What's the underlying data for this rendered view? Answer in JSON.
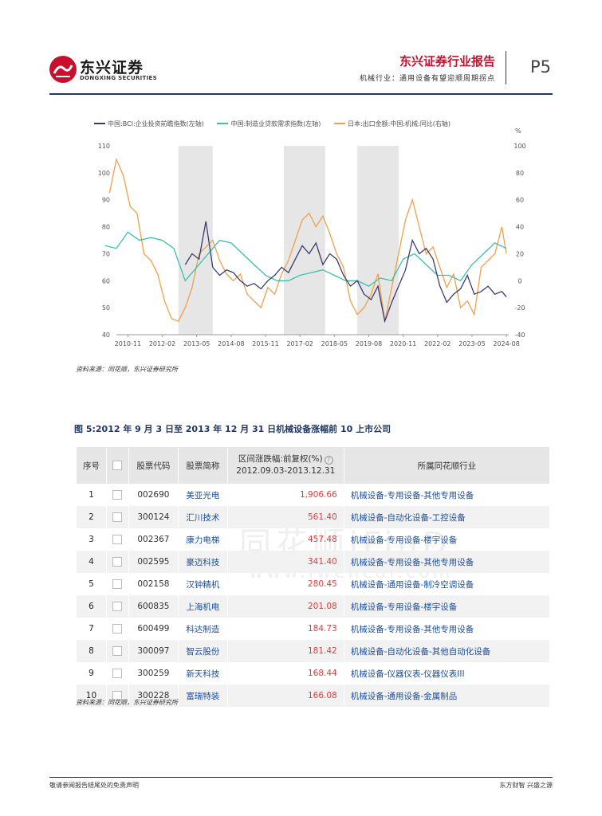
{
  "header": {
    "logo_cn": "东兴证券",
    "logo_en": "DONGXING SECURITIES",
    "report_title": "东兴证券行业报告",
    "report_subtitle": "机械行业：通用设备有望迎顺周期拐点",
    "page": "P5"
  },
  "chart_data": {
    "type": "line",
    "legend": [
      "中国:BCI:企业投资前瞻指数(左轴)",
      "中国:制造业贷款需求指数(左轴)",
      "日本:出口金额:中国:机械:同比(右轴)"
    ],
    "colors": [
      "#3b3b6e",
      "#3cbfae",
      "#f0a04b"
    ],
    "x_ticks": [
      "2010-11",
      "2012-02",
      "2013-05",
      "2014-08",
      "2015-11",
      "2017-02",
      "2018-05",
      "2019-08",
      "2020-11",
      "2022-02",
      "2023-05",
      "2024-08"
    ],
    "y_left_ticks": [
      "110",
      "100",
      "90",
      "80",
      "70",
      "60",
      "50",
      "40"
    ],
    "y_right_ticks": [
      "100",
      "80",
      "60",
      "40",
      "20",
      "0",
      "-20",
      "-40"
    ],
    "y_right_unit": "%",
    "y_left_range": [
      40,
      110
    ],
    "y_right_range": [
      -40,
      100
    ],
    "shaded_periods": [
      [
        "2012-09",
        "2013-12"
      ],
      [
        "2016-07",
        "2018-01"
      ],
      [
        "2019-03",
        "2020-09"
      ]
    ],
    "series": [
      {
        "name": "中国:BCI:企业投资前瞻指数(左轴)",
        "x": [
          "2012-12",
          "2013-03",
          "2013-06",
          "2013-09",
          "2013-12",
          "2014-03",
          "2014-06",
          "2014-09",
          "2014-12",
          "2015-03",
          "2015-06",
          "2015-09",
          "2015-12",
          "2016-03",
          "2016-06",
          "2016-09",
          "2016-12",
          "2017-03",
          "2017-06",
          "2017-09",
          "2017-12",
          "2018-03",
          "2018-06",
          "2018-09",
          "2018-12",
          "2019-03",
          "2019-06",
          "2019-09",
          "2019-12",
          "2020-03",
          "2020-06",
          "2020-09",
          "2020-12",
          "2021-03",
          "2021-06",
          "2021-09",
          "2021-12",
          "2022-03",
          "2022-06",
          "2022-09",
          "2022-12",
          "2023-03",
          "2023-06",
          "2023-09",
          "2023-12",
          "2024-03",
          "2024-06",
          "2024-08"
        ],
        "values": [
          66,
          70,
          68,
          82,
          65,
          62,
          64,
          63,
          60,
          58,
          59,
          57,
          60,
          62,
          65,
          63,
          68,
          73,
          70,
          74,
          66,
          70,
          68,
          62,
          58,
          60,
          55,
          53,
          58,
          45,
          52,
          58,
          64,
          75,
          70,
          72,
          68,
          58,
          52,
          55,
          57,
          62,
          55,
          56,
          58,
          55,
          56,
          54
        ]
      },
      {
        "name": "中国:制造业贷款需求指数(左轴)",
        "x": [
          "2010-01",
          "2010-06",
          "2010-11",
          "2011-04",
          "2011-09",
          "2012-02",
          "2012-07",
          "2012-12",
          "2013-05",
          "2013-10",
          "2014-03",
          "2014-08",
          "2015-01",
          "2015-06",
          "2015-11",
          "2016-04",
          "2016-09",
          "2017-02",
          "2017-07",
          "2017-12",
          "2018-05",
          "2018-10",
          "2019-03",
          "2019-08",
          "2020-01",
          "2020-06",
          "2020-11",
          "2021-04",
          "2021-09",
          "2022-02",
          "2022-07",
          "2022-12",
          "2023-05",
          "2023-10",
          "2024-03",
          "2024-08"
        ],
        "values": [
          73,
          72,
          78,
          75,
          76,
          75,
          72,
          60,
          65,
          70,
          75,
          74,
          70,
          66,
          62,
          60,
          60,
          62,
          63,
          64,
          62,
          60,
          60,
          58,
          61,
          60,
          68,
          70,
          66,
          62,
          62,
          60,
          66,
          70,
          74,
          72
        ]
      },
      {
        "name": "日本:出口金额:中国:机械:同比(右轴)",
        "x": [
          "2010-03",
          "2010-06",
          "2010-09",
          "2010-12",
          "2011-03",
          "2011-06",
          "2011-09",
          "2011-12",
          "2012-03",
          "2012-06",
          "2012-09",
          "2012-12",
          "2013-03",
          "2013-06",
          "2013-09",
          "2013-12",
          "2014-03",
          "2014-06",
          "2014-09",
          "2014-12",
          "2015-03",
          "2015-06",
          "2015-09",
          "2015-12",
          "2016-03",
          "2016-06",
          "2016-09",
          "2016-12",
          "2017-03",
          "2017-06",
          "2017-09",
          "2017-12",
          "2018-03",
          "2018-06",
          "2018-09",
          "2018-12",
          "2019-03",
          "2019-06",
          "2019-09",
          "2019-12",
          "2020-03",
          "2020-06",
          "2020-09",
          "2020-12",
          "2021-03",
          "2021-06",
          "2021-09",
          "2021-12",
          "2022-03",
          "2022-06",
          "2022-09",
          "2022-12",
          "2023-03",
          "2023-06",
          "2023-09",
          "2023-12",
          "2024-03",
          "2024-06",
          "2024-08"
        ],
        "values": [
          65,
          90,
          78,
          55,
          50,
          20,
          15,
          5,
          -15,
          -28,
          -30,
          -20,
          -5,
          20,
          25,
          30,
          15,
          5,
          0,
          5,
          -10,
          -15,
          -20,
          -5,
          -10,
          5,
          15,
          30,
          45,
          50,
          40,
          48,
          35,
          20,
          10,
          -15,
          -25,
          -20,
          -10,
          5,
          -30,
          -5,
          20,
          45,
          60,
          40,
          20,
          25,
          10,
          -5,
          5,
          -20,
          -15,
          -25,
          10,
          15,
          20,
          40,
          20
        ]
      }
    ]
  },
  "chart_source": "资料来源：同花顺，东兴证券研究所",
  "table": {
    "figure_title": "图 5:2012 年 9 月 3 日至 2013 年 12 月 31 日机械设备涨幅前 10 上市公司",
    "headers": {
      "idx": "序号",
      "code": "股票代码",
      "name": "股票简称",
      "range_line1": "区间涨跌幅:前复权(%)",
      "range_line2": "2012.09.03-2013.12.31",
      "industry": "所属同花顺行业"
    },
    "rows": [
      {
        "idx": "1",
        "code": "002690",
        "name": "美亚光电",
        "pct": "1,906.66",
        "industry": "机械设备-专用设备-其他专用设备"
      },
      {
        "idx": "2",
        "code": "300124",
        "name": "汇川技术",
        "pct": "561.40",
        "industry": "机械设备-自动化设备-工控设备"
      },
      {
        "idx": "3",
        "code": "002367",
        "name": "康力电梯",
        "pct": "457.48",
        "industry": "机械设备-专用设备-楼宇设备"
      },
      {
        "idx": "4",
        "code": "002595",
        "name": "豪迈科技",
        "pct": "341.40",
        "industry": "机械设备-专用设备-其他专用设备"
      },
      {
        "idx": "5",
        "code": "002158",
        "name": "汉钟精机",
        "pct": "280.45",
        "industry": "机械设备-通用设备-制冷空调设备"
      },
      {
        "idx": "6",
        "code": "600835",
        "name": "上海机电",
        "pct": "201.08",
        "industry": "机械设备-专用设备-楼宇设备"
      },
      {
        "idx": "7",
        "code": "600499",
        "name": "科达制造",
        "pct": "184.73",
        "industry": "机械设备-专用设备-其他专用设备"
      },
      {
        "idx": "8",
        "code": "300097",
        "name": "智云股份",
        "pct": "181.42",
        "industry": "机械设备-自动化设备-其他自动化设备"
      },
      {
        "idx": "9",
        "code": "300259",
        "name": "新天科技",
        "pct": "168.44",
        "industry": "机械设备-仪器仪表-仪器仪表III"
      },
      {
        "idx": "10",
        "code": "300228",
        "name": "富瑞特装",
        "pct": "166.08",
        "industry": "机械设备-通用设备-金属制品"
      }
    ]
  },
  "table_source": "资料来源：同花顺，东兴证券研究所",
  "watermark": "同花顺iFinD",
  "watermark_sub": "www.iwencai.com",
  "footer": {
    "left": "敬请参阅报告结尾处的免责声明",
    "right": "东方财智  兴盛之源"
  }
}
